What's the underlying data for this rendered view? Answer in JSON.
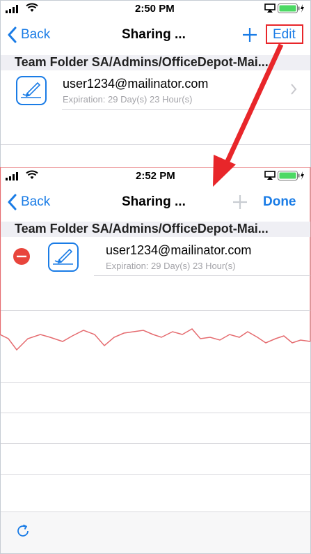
{
  "colors": {
    "accent": "#1a7ce6",
    "annotation_red": "#e8262a",
    "section_bg": "#efeff4",
    "delete_red": "#e8453c",
    "battery_green": "#4cd964"
  },
  "top": {
    "status": {
      "time": "2:50 PM"
    },
    "nav": {
      "back_label": "Back",
      "title": "Sharing ...",
      "add_icon": "plus-icon",
      "edit_label": "Edit"
    },
    "section_header": "Team Folder SA/Admins/OfficeDepot-Mai...",
    "item": {
      "email": "user1234@mailinator.com",
      "expiration": "Expiration: 29 Day(s) 23 Hour(s)",
      "icon": "document-edit-icon",
      "chevron": "chevron-right-icon"
    }
  },
  "bottom": {
    "status": {
      "time": "2:52 PM"
    },
    "nav": {
      "back_label": "Back",
      "title": "Sharing ...",
      "add_icon": "plus-icon",
      "done_label": "Done"
    },
    "section_header": "Team Folder SA/Admins/OfficeDepot-Mai...",
    "item": {
      "email": "user1234@mailinator.com",
      "expiration": "Expiration: 29 Day(s) 23 Hour(s)",
      "icon": "document-edit-icon",
      "delete_icon": "minus-circle-icon"
    },
    "toolbar": {
      "refresh_icon": "refresh-icon"
    }
  }
}
